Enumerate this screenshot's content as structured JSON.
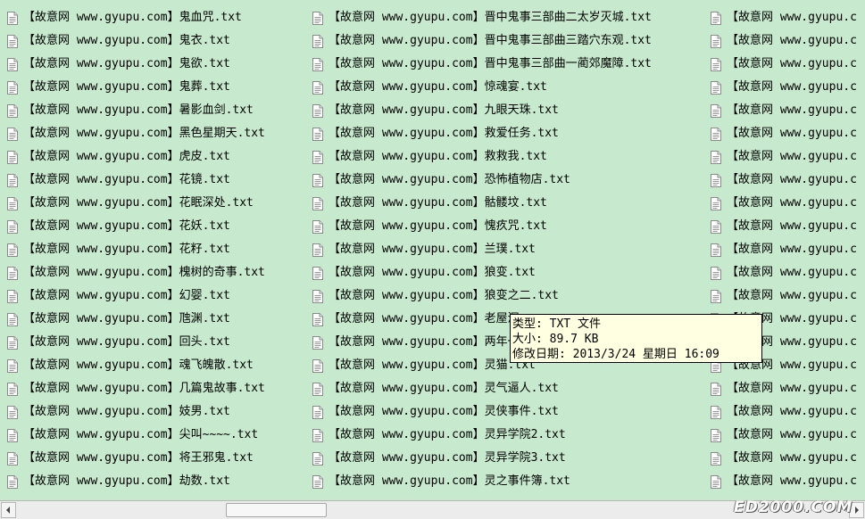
{
  "columns": [
    [
      "【故意网 www.gyupu.com】鬼血咒.txt",
      "【故意网 www.gyupu.com】鬼衣.txt",
      "【故意网 www.gyupu.com】鬼欲.txt",
      "【故意网 www.gyupu.com】鬼葬.txt",
      "【故意网 www.gyupu.com】暑影血剑.txt",
      "【故意网 www.gyupu.com】黑色星期天.txt",
      "【故意网 www.gyupu.com】虎皮.txt",
      "【故意网 www.gyupu.com】花镜.txt",
      "【故意网 www.gyupu.com】花眠深处.txt",
      "【故意网 www.gyupu.com】花妖.txt",
      "【故意网 www.gyupu.com】花籽.txt",
      "【故意网 www.gyupu.com】槐树的奇事.txt",
      "【故意网 www.gyupu.com】幻婴.txt",
      "【故意网 www.gyupu.com】虺渊.txt",
      "【故意网 www.gyupu.com】回头.txt",
      "【故意网 www.gyupu.com】魂飞魄散.txt",
      "【故意网 www.gyupu.com】几篇鬼故事.txt",
      "【故意网 www.gyupu.com】妓男.txt",
      "【故意网 www.gyupu.com】尖叫~~~~.txt",
      "【故意网 www.gyupu.com】将王邪鬼.txt",
      "【故意网 www.gyupu.com】劫数.txt"
    ],
    [
      "【故意网 www.gyupu.com】晋中鬼事三部曲二太岁灭城.txt",
      "【故意网 www.gyupu.com】晋中鬼事三部曲三踏穴东观.txt",
      "【故意网 www.gyupu.com】晋中鬼事三部曲一蔺郊魔障.txt",
      "【故意网 www.gyupu.com】惊魂宴.txt",
      "【故意网 www.gyupu.com】九眼天珠.txt",
      "【故意网 www.gyupu.com】救爱任务.txt",
      "【故意网 www.gyupu.com】救救我.txt",
      "【故意网 www.gyupu.com】恐怖植物店.txt",
      "【故意网 www.gyupu.com】骷髅坟.txt",
      "【故意网 www.gyupu.com】愧疚咒.txt",
      "【故意网 www.gyupu.com】兰璞.txt",
      "【故意网 www.gyupu.com】狼变.txt",
      "【故意网 www.gyupu.com】狼变之二.txt",
      "【故意网 www.gyupu.com】老屋深",
      "【故意网 www.gyupu.com】两年一",
      "【故意网 www.gyupu.com】灵猫.txt",
      "【故意网 www.gyupu.com】灵气逼人.txt",
      "【故意网 www.gyupu.com】灵侠事件.txt",
      "【故意网 www.gyupu.com】灵异学院2.txt",
      "【故意网 www.gyupu.com】灵异学院3.txt",
      "【故意网 www.gyupu.com】灵之事件簿.txt"
    ],
    [
      "【故意网 www.gyupu.c",
      "【故意网 www.gyupu.c",
      "【故意网 www.gyupu.c",
      "【故意网 www.gyupu.c",
      "【故意网 www.gyupu.c",
      "【故意网 www.gyupu.c",
      "【故意网 www.gyupu.c",
      "【故意网 www.gyupu.c",
      "【故意网 www.gyupu.c",
      "【故意网 www.gyupu.c",
      "【故意网 www.gyupu.c",
      "【故意网 www.gyupu.c",
      "【故意网 www.gyupu.c",
      "【故意网 www.gyupu.c",
      "【故意网 www.gyupu.c",
      "【故意网 www.gyupu.c",
      "【故意网 www.gyupu.c",
      "【故意网 www.gyupu.c",
      "【故意网 www.gyupu.c",
      "【故意网 www.gyupu.c",
      "【故意网 www.gyupu.c"
    ]
  ],
  "icon": "text-file-icon",
  "tooltip": {
    "type_line": "类型: TXT 文件",
    "size_line": "大小: 89.7 KB",
    "date_line": "修改日期: 2013/3/24 星期日 16:09"
  },
  "watermark": "ED2000.COM",
  "colors": {
    "background": "#c7e9cd",
    "tooltip_bg": "#ffffe1"
  }
}
